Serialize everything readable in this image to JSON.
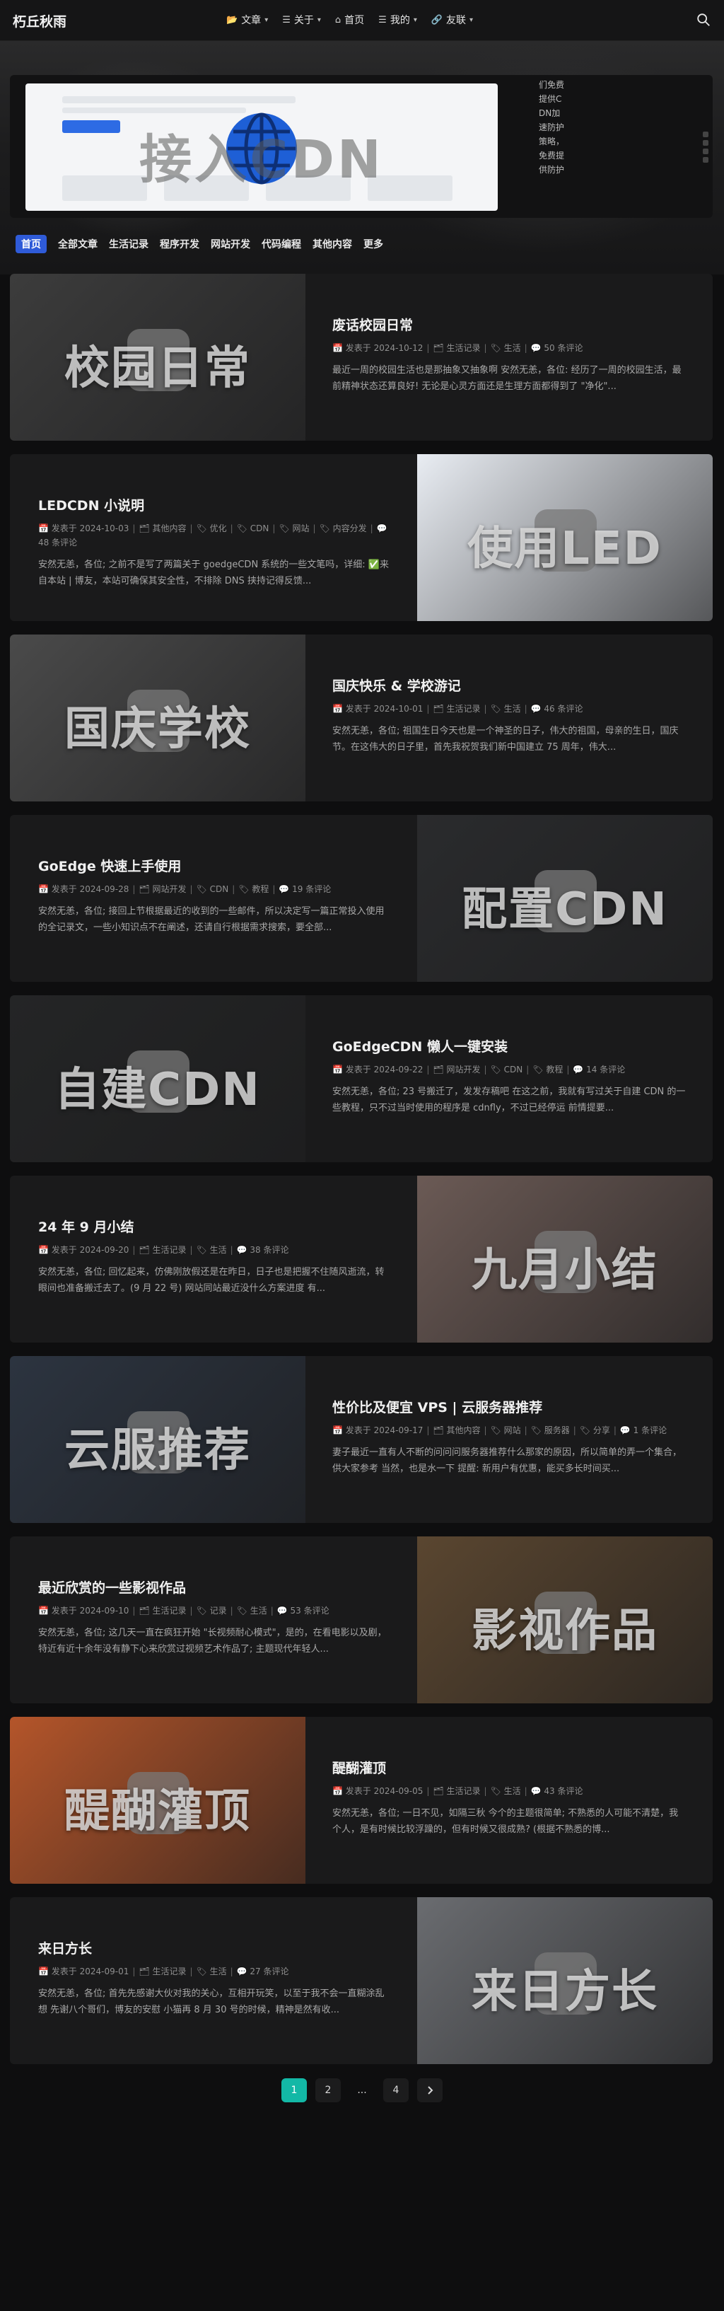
{
  "site": {
    "logo": "朽丘秋雨"
  },
  "nav": [
    {
      "label": "文章",
      "icon": "folder-icon",
      "has_dropdown": true
    },
    {
      "label": "关于",
      "icon": "list-icon",
      "has_dropdown": true
    },
    {
      "label": "首页",
      "icon": "home-icon",
      "has_dropdown": false
    },
    {
      "label": "我的",
      "icon": "list-icon",
      "has_dropdown": true
    },
    {
      "label": "友联",
      "icon": "link-icon",
      "has_dropdown": true
    }
  ],
  "hero": {
    "slide_caption": "接入CDN",
    "side_text": "们免费提供CDN加速防护策略，免费提供防护"
  },
  "categories": [
    "首页",
    "全部文章",
    "生活记录",
    "程序开发",
    "网站开发",
    "代码编程",
    "其他内容",
    "更多"
  ],
  "posts": [
    {
      "title": "废话校园日常",
      "date_prefix": "发表于",
      "date": "2024-10-12",
      "category": "生活记录",
      "tags": [
        "生活"
      ],
      "comments": "50 条评论",
      "excerpt": "最近一周的校园生活也是那抽象又抽象啊 安然无恙，各位: 经历了一周的校园生活，最前精神状态还算良好! 无论是心灵方面还是生理方面都得到了 \"净化\"...",
      "thumb_caption": "校园日常",
      "thumb_color": "#3c3c3c"
    },
    {
      "title": "LEDCDN 小说明",
      "date_prefix": "发表于",
      "date": "2024-10-03",
      "category": "其他内容",
      "tags": [
        "优化",
        "CDN",
        "网站",
        "内容分发"
      ],
      "comments": "48 条评论",
      "excerpt": "安然无恙，各位; 之前不是写了两篇关于 goedgeCDN 系统的一些文笔吗，详细: ✅来自本站 | 博友，本站可确保其安全性，不排除 DNS 挟持记得反馈...",
      "thumb_caption": "使用LED",
      "thumb_color": "#e9edf3"
    },
    {
      "title": "国庆快乐 & 学校游记",
      "date_prefix": "发表于",
      "date": "2024-10-01",
      "category": "生活记录",
      "tags": [
        "生活"
      ],
      "comments": "46 条评论",
      "excerpt": "安然无恙，各位; 祖国生日今天也是一个神圣的日子，伟大的祖国，母亲的生日，国庆节。在这伟大的日子里，首先我祝贺我们新中国建立 75 周年，伟大...",
      "thumb_caption": "国庆学校",
      "thumb_color": "#4a4a4a"
    },
    {
      "title": "GoEdge 快速上手使用",
      "date_prefix": "发表于",
      "date": "2024-09-28",
      "category": "网站开发",
      "tags": [
        "CDN",
        "教程"
      ],
      "comments": "19 条评论",
      "excerpt": "安然无恙，各位; 接回上节根据最近的收到的一些邮件，所以决定写一篇正常投入使用的全记录文，一些小知识点不在阐述，还请自行根据需求搜索，要全部...",
      "thumb_caption": "配置CDN",
      "thumb_color": "#2a2b2d"
    },
    {
      "title": "GoEdgeCDN 懒人一键安装",
      "date_prefix": "发表于",
      "date": "2024-09-22",
      "category": "网站开发",
      "tags": [
        "CDN",
        "教程"
      ],
      "comments": "14 条评论",
      "excerpt": "安然无恙，各位; 23 号搬迁了，发发存稿吧 在这之前，我就有写过关于自建 CDN 的一些教程，只不过当时使用的程序是 cdnfly，不过已经停运 前情提要...",
      "thumb_caption": "自建CDN",
      "thumb_color": "#242526"
    },
    {
      "title": "24 年 9 月小结",
      "date_prefix": "发表于",
      "date": "2024-09-20",
      "category": "生活记录",
      "tags": [
        "生活"
      ],
      "comments": "38 条评论",
      "excerpt": "安然无恙，各位; 回忆起来，仿佛刚放假还是在昨日，日子也是把握不住随风逝流，转眼间也准备搬迁去了。(9 月 22 号) 网站同站最近没什么方案进度 有...",
      "thumb_caption": "九月小结",
      "thumb_color": "#6b5a55"
    },
    {
      "title": "性价比及便宜 VPS | 云服务器推荐",
      "date_prefix": "发表于",
      "date": "2024-09-17",
      "category": "其他内容",
      "tags": [
        "网站",
        "服务器",
        "分享"
      ],
      "comments": "1 条评论",
      "excerpt": "妻子最近一直有人不断的问问问服务器推荐什么那家的原因，所以简单的弄一个集合，供大家参考 当然，也是水一下 提醒: 新用户有优惠，能买多长时间买...",
      "thumb_caption": "云服推荐",
      "thumb_color": "#2c3440"
    },
    {
      "title": "最近欣赏的一些影视作品",
      "date_prefix": "发表于",
      "date": "2024-09-10",
      "category": "生活记录",
      "tags": [
        "记录",
        "生活"
      ],
      "comments": "53 条评论",
      "excerpt": "安然无恙，各位; 这几天一直在疯狂开始 \"长视频耐心模式\"，是的，在看电影以及剧，特近有近十余年没有静下心来欣赏过视频艺术作品了; 主题现代年轻人...",
      "thumb_caption": "影视作品",
      "thumb_color": "#5a4630"
    },
    {
      "title": "醍醐灌顶",
      "date_prefix": "发表于",
      "date": "2024-09-05",
      "category": "生活记录",
      "tags": [
        "生活"
      ],
      "comments": "43 条评论",
      "excerpt": "安然无恙，各位; 一日不见，如隔三秋 今个的主题很简单; 不熟悉的人可能不清楚，我个人，是有时候比较浮躁的，但有时候又很成熟? (根据不熟悉的博...",
      "thumb_caption": "醍醐灌顶",
      "thumb_color": "#b4552a"
    },
    {
      "title": "来日方长",
      "date_prefix": "发表于",
      "date": "2024-09-01",
      "category": "生活记录",
      "tags": [
        "生活"
      ],
      "comments": "27 条评论",
      "excerpt": "安然无恙，各位; 首先先感谢大伙对我的关心，互相开玩笑，以至于我不会一直糊涂乱想 先谢八个哥们，博友的安慰 小猫再 8 月 30 号的时候，精神是然有收...",
      "thumb_caption": "来日方长",
      "thumb_color": "#6a6c70"
    }
  ],
  "pagination": {
    "pages": [
      "1",
      "2",
      "...",
      "4"
    ],
    "current": "1",
    "next_icon": "chevron-right-icon"
  },
  "colors": {
    "accent": "#13b8a6",
    "active_tab": "#2f5bd8",
    "background": "#0e0e0f",
    "card": "#1a1a1b"
  }
}
